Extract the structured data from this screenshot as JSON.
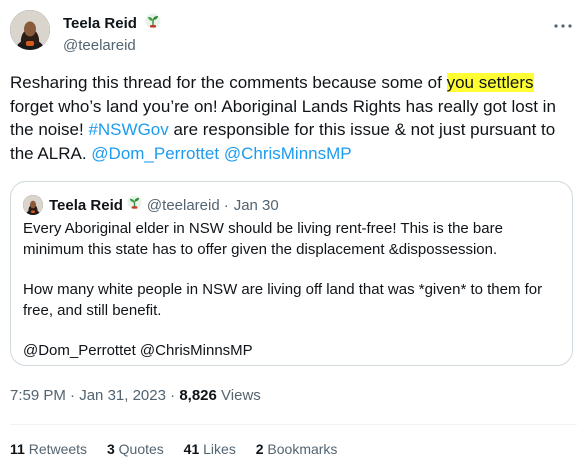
{
  "author": {
    "display_name": "Teela Reid",
    "handle": "@teelareid"
  },
  "tweet": {
    "text_before_highlight": "Resharing this thread for the comments because some of ",
    "highlight": "you settlers",
    "text_after_highlight": " forget who’s land you’re on! Aboriginal Lands Rights has really got lost in the noise! ",
    "hashtag": "#NSWGov",
    "text_after_hashtag": " are responsible for this issue & not just pursuant to the ALRA. ",
    "mention_1": "@Dom_Perrottet",
    "mention_2": "@ChrisMinnsMP"
  },
  "quote": {
    "display_name": "Teela Reid",
    "handle": "@teelareid",
    "separator": "·",
    "date": "Jan 30",
    "para_1": "Every Aboriginal elder in NSW should be living rent-free! This is the bare minimum this state has to offer given the displacement &dispossession.",
    "para_2": "How many white people in NSW are living off land that was *given* to them for free, and still benefit.",
    "para_3": "@Dom_Perrottet @ChrisMinnsMP"
  },
  "meta": {
    "time": "7:59 PM",
    "separator_1": "·",
    "date": "Jan 31, 2023",
    "separator_2": "·",
    "views_count": "8,826",
    "views_label": "Views"
  },
  "stats": {
    "retweets_count": "11",
    "retweets_label": "Retweets",
    "quotes_count": "3",
    "quotes_label": "Quotes",
    "likes_count": "41",
    "likes_label": "Likes",
    "bookmarks_count": "2",
    "bookmarks_label": "Bookmarks"
  },
  "icons": {
    "more": "more-options-icon",
    "name_emoji": "seedling-emoji-icon"
  },
  "colors": {
    "link": "#1d9bf0",
    "highlight": "#ffff33",
    "secondary_text": "#536471",
    "border": "#cfd9de"
  }
}
